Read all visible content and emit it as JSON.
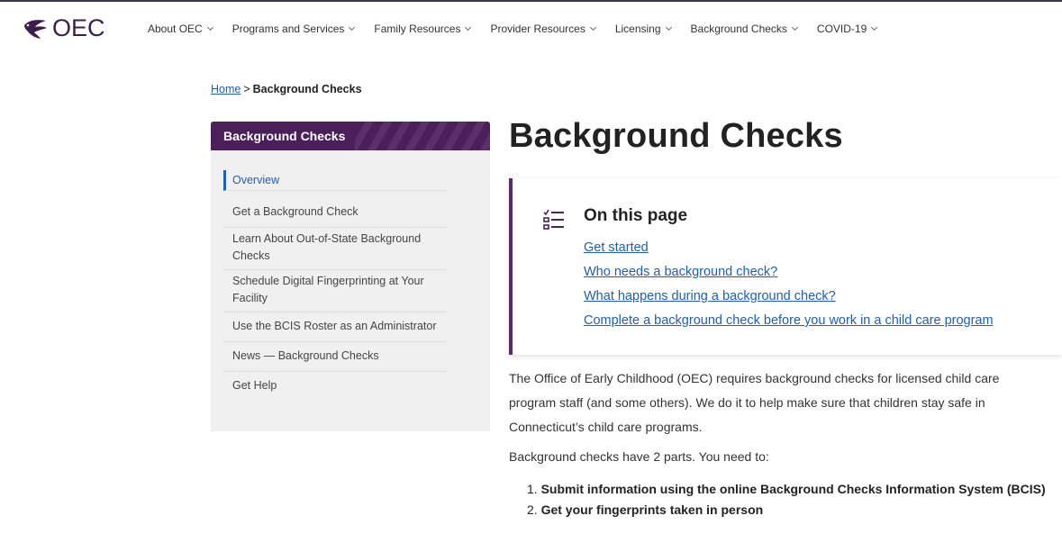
{
  "logo": {
    "text": "OEC"
  },
  "nav": [
    {
      "label": "About OEC"
    },
    {
      "label": "Programs and Services"
    },
    {
      "label": "Family Resources"
    },
    {
      "label": "Provider Resources"
    },
    {
      "label": "Licensing"
    },
    {
      "label": "Background Checks"
    },
    {
      "label": "COVID-19"
    }
  ],
  "breadcrumb": {
    "home": "Home",
    "separator": ">",
    "current": "Background Checks"
  },
  "sidebar": {
    "title": "Background Checks",
    "items": [
      {
        "label": "Overview",
        "active": true
      },
      {
        "label": "Get a Background Check"
      },
      {
        "label": "Learn About Out-of-State Background Checks"
      },
      {
        "label": "Schedule Digital Fingerprinting at Your Facility"
      },
      {
        "label": "Use the BCIS Roster as an Administrator"
      },
      {
        "label": "News — Background Checks"
      },
      {
        "label": "Get Help"
      }
    ]
  },
  "main": {
    "title": "Background Checks",
    "on_this_page": {
      "title": "On this page",
      "links": [
        "Get started",
        "Who needs a background check?",
        "What happens during a background check?",
        "Complete a background check before you work in a child care program"
      ]
    },
    "paragraphs": [
      "The Office of Early Childhood (OEC) requires background checks for licensed child care program staff (and some others). We do it to help make sure that children stay safe in Connecticut’s child care programs.",
      "Background checks have 2 parts. You need to:"
    ],
    "steps": [
      {
        "number": "1.",
        "text": "Submit information using the online Background Checks Information System (BCIS)"
      },
      {
        "number": "2.",
        "text": "Get your fingerprints taken in person"
      }
    ]
  },
  "colors": {
    "brand_purple": "#4b1f5a",
    "accent_border": "#5a2a6e",
    "link_blue": "#1f5fb0"
  },
  "icons": {
    "logo": "oec-bird-logo-icon",
    "chevron": "chevron-down-icon",
    "checklist": "checklist-icon"
  }
}
